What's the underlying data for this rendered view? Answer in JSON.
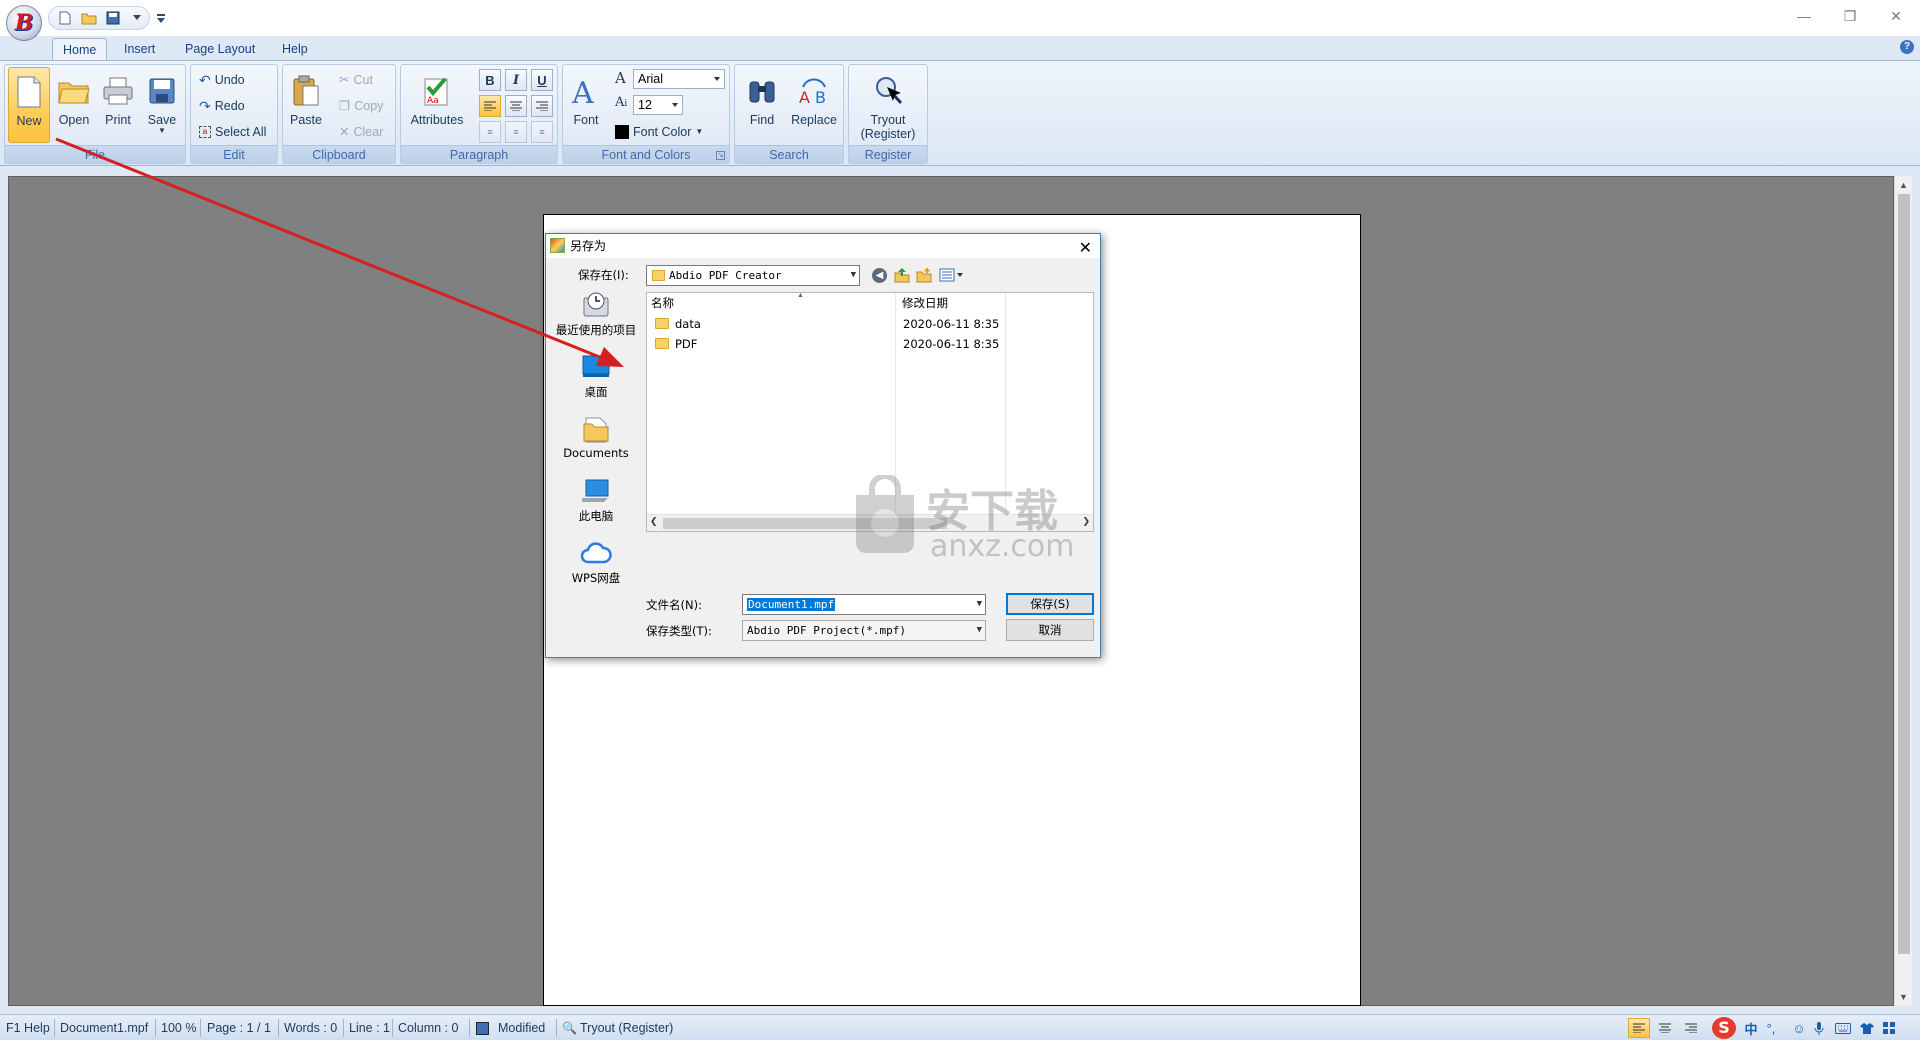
{
  "ribbon": {
    "tabs": [
      "Home",
      "Insert",
      "Page Layout",
      "Help"
    ],
    "file_group": {
      "label": "File",
      "new": "New",
      "open": "Open",
      "print": "Print",
      "save": "Save"
    },
    "edit_group": {
      "label": "Edit",
      "undo": "Undo",
      "redo": "Redo",
      "select_all": "Select All"
    },
    "clipboard_group": {
      "label": "Clipboard",
      "paste": "Paste",
      "cut": "Cut",
      "copy": "Copy",
      "clear": "Clear"
    },
    "paragraph_group": {
      "label": "Paragraph",
      "attributes": "Attributes",
      "bold": "B",
      "italic": "I",
      "underline": "U"
    },
    "font_group": {
      "label": "Font and Colors",
      "font": "Font",
      "font_name": "Arial",
      "font_size": "12",
      "font_color": "Font Color"
    },
    "search_group": {
      "label": "Search",
      "find": "Find",
      "replace": "Replace"
    },
    "register_group": {
      "label": "Register",
      "tryout_line1": "Tryout",
      "tryout_line2": "(Register)"
    }
  },
  "dialog": {
    "title": "另存为",
    "save_in_label": "保存在(I):",
    "save_in_value": "Abdio PDF Creator",
    "places": [
      "最近使用的项目",
      "桌面",
      "Documents",
      "此电脑",
      "WPS网盘"
    ],
    "columns": {
      "name": "名称",
      "date": "修改日期"
    },
    "files": [
      {
        "name": "data",
        "date": "2020-06-11 8:35"
      },
      {
        "name": "PDF",
        "date": "2020-06-11 8:35"
      }
    ],
    "filename_label": "文件名(N):",
    "filename_value": "Document1.mpf",
    "filetype_label": "保存类型(T):",
    "filetype_value": "Abdio PDF Project(*.mpf)",
    "save_button": "保存(S)",
    "cancel_button": "取消"
  },
  "watermark": {
    "brand": "安下载",
    "domain": "anxz.com"
  },
  "statusbar": {
    "help": "F1 Help",
    "document": "Document1.mpf",
    "zoom": "100 %",
    "page": "Page : 1 / 1",
    "words": "Words : 0",
    "line": "Line : 1",
    "column": "Column : 0",
    "modified": "Modified",
    "tryout": "Tryout (Register)",
    "ime": "中"
  },
  "colors": {
    "accent": "#15428b",
    "annotation_arrow": "#d42020",
    "workspace": "#808080",
    "highlight": "#ffc23b"
  }
}
